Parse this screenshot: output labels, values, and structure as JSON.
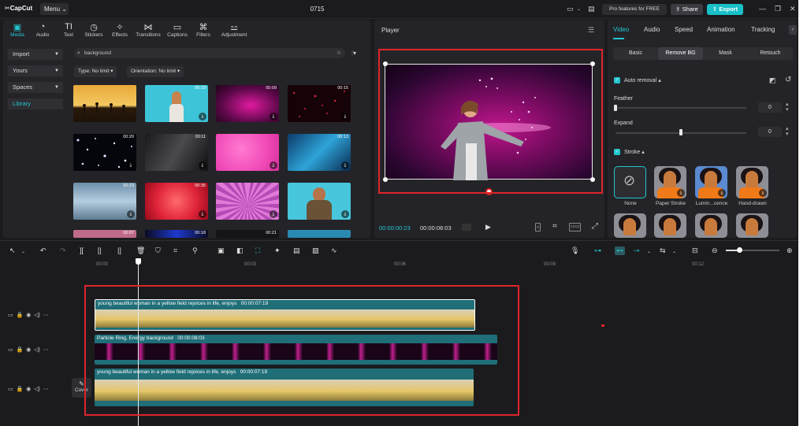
{
  "app": {
    "logo": "CapCut",
    "menu_label": "Menu",
    "project_name": "0715",
    "pro_label": "Pro features for FREE",
    "share_label": "Share",
    "export_label": "Export",
    "colors": {
      "accent": "#22c6d0",
      "highlight_box": "#e0242b",
      "bg": "#1b1b1e",
      "panel": "#242428"
    }
  },
  "media_tabs": [
    {
      "label": "Media",
      "icon": "media-icon",
      "active": true
    },
    {
      "label": "Audio",
      "icon": "audio-icon"
    },
    {
      "label": "Text",
      "icon": "text-icon"
    },
    {
      "label": "Stickers",
      "icon": "stickers-icon"
    },
    {
      "label": "Effects",
      "icon": "effects-icon"
    },
    {
      "label": "Transitions",
      "icon": "transitions-icon"
    },
    {
      "label": "Captions",
      "icon": "captions-icon"
    },
    {
      "label": "Filters",
      "icon": "filters-icon"
    },
    {
      "label": "Adjustment",
      "icon": "adjustment-icon"
    }
  ],
  "sidebar": {
    "items": [
      {
        "label": "Import"
      },
      {
        "label": "Yours"
      },
      {
        "label": "Spaces"
      },
      {
        "label": "Library",
        "active": true
      }
    ]
  },
  "library": {
    "search_value": "background",
    "filter_type": "Type: No limit",
    "filter_orientation": "Orientation: No limit",
    "thumbnails": [
      {
        "duration": "",
        "style": "sunset"
      },
      {
        "duration": "00:19",
        "style": "woman"
      },
      {
        "duration": "00:09",
        "style": "pink-particles"
      },
      {
        "duration": "00:15",
        "style": "red-dots"
      },
      {
        "duration": "00:20",
        "style": "blue-sparkles"
      },
      {
        "duration": "00:11",
        "style": "dark-smoke"
      },
      {
        "duration": "",
        "style": "pink-bokeh"
      },
      {
        "duration": "00:13",
        "style": "blue-lights"
      },
      {
        "duration": "00:23",
        "style": "ice"
      },
      {
        "duration": "00:35",
        "style": "red-bokeh"
      },
      {
        "duration": "",
        "style": "purple-rays"
      },
      {
        "duration": "",
        "style": "man"
      },
      {
        "duration": "00:07",
        "style": "pink-strip"
      },
      {
        "duration": "00:18",
        "style": "blue-strip"
      },
      {
        "duration": "00:21",
        "style": "dark-strip"
      },
      {
        "duration": "",
        "style": "cyan-strip"
      }
    ]
  },
  "player": {
    "title": "Player",
    "current_time": "00:00:00:23",
    "total_time": "00:00:08:03"
  },
  "properties": {
    "tabs": [
      {
        "label": "Video",
        "active": true
      },
      {
        "label": "Audio"
      },
      {
        "label": "Speed"
      },
      {
        "label": "Animation"
      },
      {
        "label": "Tracking"
      }
    ],
    "subtabs": [
      {
        "label": "Basic"
      },
      {
        "label": "Remove BG",
        "active": true
      },
      {
        "label": "Mask"
      },
      {
        "label": "Retouch"
      }
    ],
    "auto_removal_label": "Auto removal",
    "feather_label": "Feather",
    "feather_value": "0",
    "feather_level": 0,
    "expand_label": "Expand",
    "expand_value": "0",
    "expand_level": 0.5,
    "stroke_label": "Stroke",
    "stroke_options": [
      {
        "label": "None",
        "selected": true
      },
      {
        "label": "Paper Stroke"
      },
      {
        "label": "Lumin...cence"
      },
      {
        "label": "Hand-drawn"
      }
    ]
  },
  "timeline": {
    "ruler_labels": [
      "00:00",
      "00:03",
      "00:06",
      "00:09",
      "00:12"
    ],
    "playhead_fraction": 0.06,
    "cover_label": "Cover",
    "clips": [
      {
        "title": "young beautiful woman in a yellow field rejoices in life, enjoys",
        "duration": "00:00:07:19",
        "style": "field"
      },
      {
        "title": "Particle Ring, Energy background",
        "duration": "00:00:08:03",
        "style": "particles"
      },
      {
        "title": "young beautiful woman in a yellow field rejoices in life, enjoys",
        "duration": "00:00:07:19",
        "style": "field"
      }
    ]
  }
}
